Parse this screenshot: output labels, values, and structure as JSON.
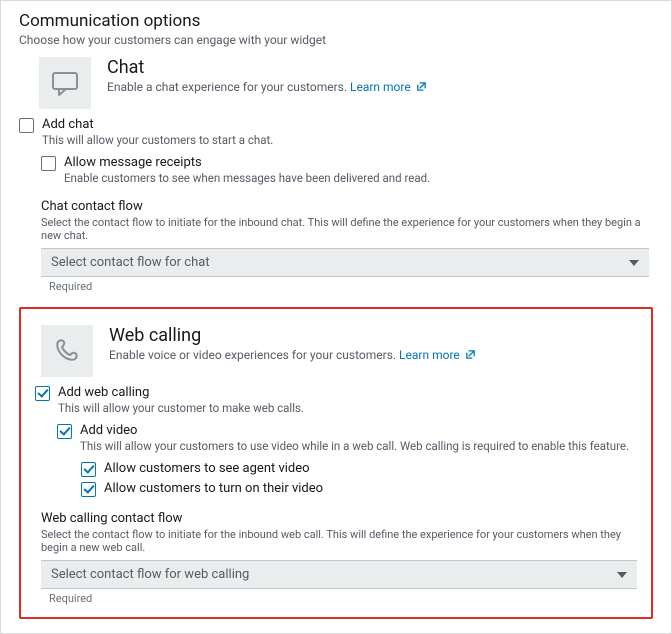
{
  "header": {
    "title": "Communication options",
    "subtitle": "Choose how your customers can engage with your widget"
  },
  "chat": {
    "title": "Chat",
    "desc": "Enable a chat experience for your customers.",
    "learn_more": "Learn more",
    "add_label": "Add chat",
    "add_desc": "This will allow your customers to start a chat.",
    "receipts_label": "Allow message receipts",
    "receipts_desc": "Enable customers to see when messages have been delivered and read.",
    "flow_title": "Chat contact flow",
    "flow_desc": "Select the contact flow to initiate for the inbound chat. This will define the experience for your customers when they begin a new chat.",
    "flow_placeholder": "Select contact flow for chat",
    "required": "Required"
  },
  "web": {
    "title": "Web calling",
    "desc": "Enable voice or video experiences for your customers.",
    "learn_more": "Learn more",
    "add_label": "Add web calling",
    "add_desc": "This will allow your customer to make web calls.",
    "video_label": "Add video",
    "video_desc": "This will allow your customers to use video while in a web call. Web calling is required to enable this feature.",
    "see_agent_label": "Allow customers to see agent video",
    "turn_on_label": "Allow customers to turn on their video",
    "flow_title": "Web calling contact flow",
    "flow_desc": "Select the contact flow to initiate for the inbound web call. This will define the experience for your customers when they begin a new web call.",
    "flow_placeholder": "Select contact flow for web calling",
    "required": "Required"
  }
}
